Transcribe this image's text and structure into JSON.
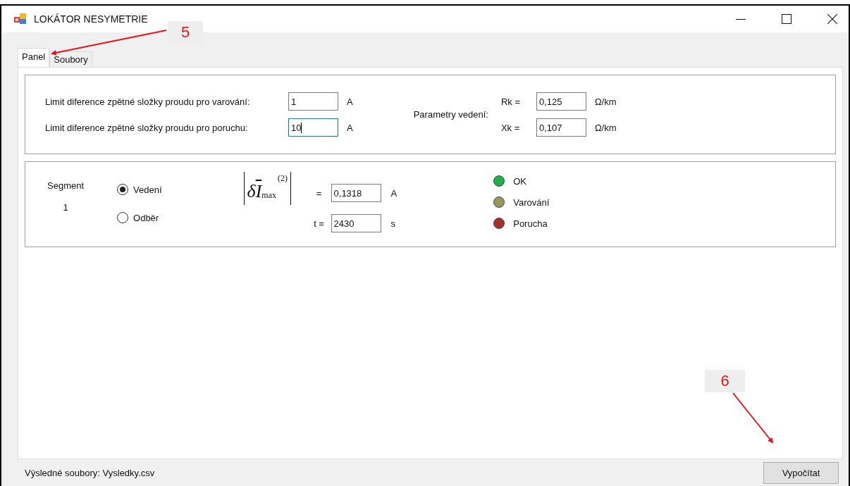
{
  "window": {
    "title": "LOKÁTOR NESYMETRIE"
  },
  "tabs": [
    {
      "label": "Panel",
      "selected": true
    },
    {
      "label": "Soubory",
      "selected": false
    }
  ],
  "limits": [
    {
      "label": "Limit diference zpětné složky proudu pro varování:",
      "value": "1",
      "unit": "A",
      "focused": false
    },
    {
      "label": "Limit diference zpětné složky proudu pro poruchu:",
      "value": "10",
      "unit": "A",
      "focused": true
    }
  ],
  "line_parameters": {
    "label": "Parametry vedení:",
    "rows": [
      {
        "label": "Rk =",
        "value": "0,125",
        "unit": "Ω/km"
      },
      {
        "label": "Xk =",
        "value": "0,107",
        "unit": "Ω/km"
      }
    ]
  },
  "segment": {
    "label": "Segment",
    "number": "1",
    "options": [
      {
        "label": "Vedení",
        "selected": true
      },
      {
        "label": "Odběr",
        "selected": false
      }
    ],
    "formula": {
      "symbol": "δ",
      "variable": "I",
      "subscript": "max",
      "superscript": "(2)"
    },
    "rows": [
      {
        "label": "=",
        "value": "0,1318",
        "unit": "A"
      },
      {
        "label": "t =",
        "value": "2430",
        "unit": "s"
      }
    ]
  },
  "legend": [
    {
      "label": "OK",
      "color": "#1fb04a"
    },
    {
      "label": "Varování",
      "color": "#9b9660"
    },
    {
      "label": "Porucha",
      "color": "#a3302c"
    }
  ],
  "status": "Výsledné soubory: Vysledky.csv",
  "buttons": [
    "Vypočítat"
  ],
  "annotations": [
    {
      "label": "5"
    },
    {
      "label": "6"
    }
  ]
}
